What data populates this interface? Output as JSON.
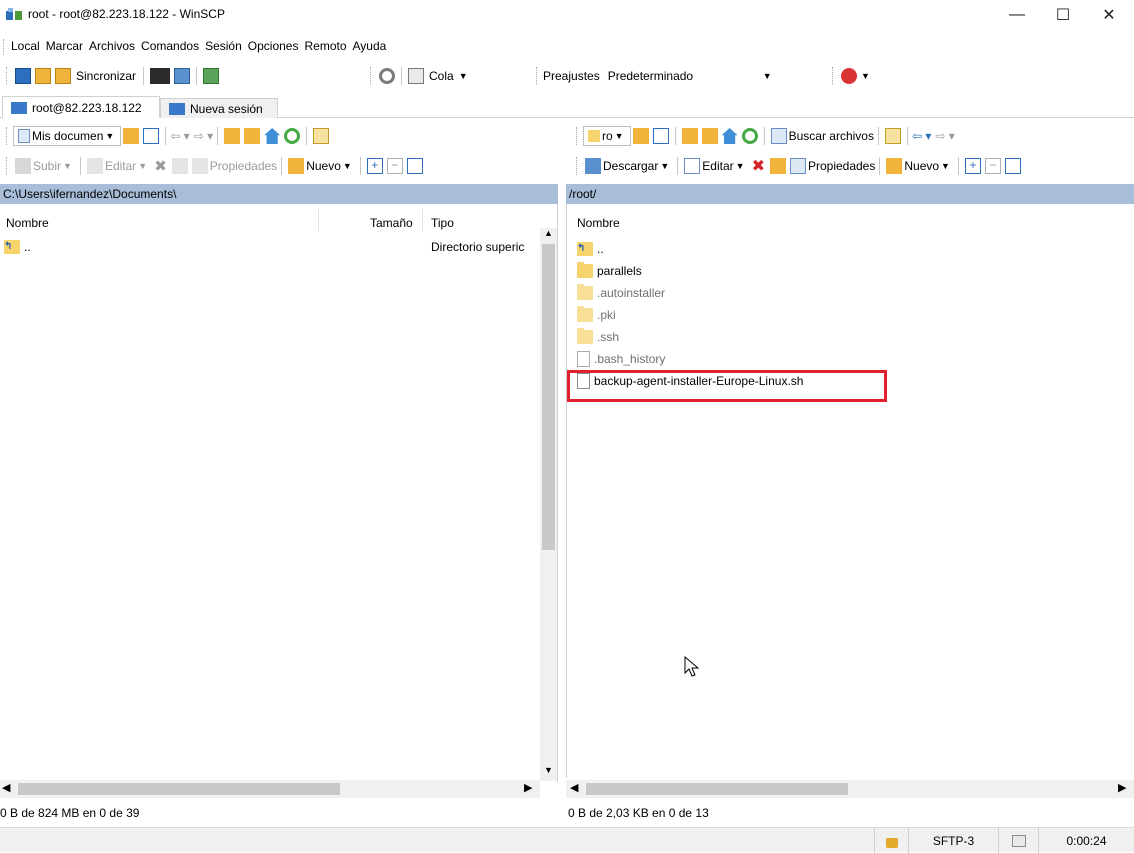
{
  "window": {
    "title": "root - root@82.223.18.122 - WinSCP",
    "controls": {
      "minimize": "—",
      "maximize": "☐",
      "close": "✕"
    }
  },
  "menubar": {
    "items": [
      "Local",
      "Marcar",
      "Archivos",
      "Comandos",
      "Sesión",
      "Opciones",
      "Remoto",
      "Ayuda"
    ]
  },
  "toolbar": {
    "sync_label": "Sincronizar",
    "queue_label": "Cola",
    "presets_label": "Preajustes",
    "presets_value": "Predeterminado"
  },
  "tabs": {
    "session": "root@82.223.18.122",
    "new_session": "Nueva sesión"
  },
  "left_panel": {
    "location_dropdown": "Mis documen",
    "upload_label": "Subir",
    "edit_label": "Editar",
    "properties_label": "Propiedades",
    "new_label": "Nuevo",
    "path": "C:\\Users\\ifernandez\\Documents\\",
    "columns": [
      "Nombre",
      "Tamaño",
      "Tipo"
    ],
    "rows": [
      {
        "name": "..",
        "size": "",
        "type": "Directorio superic"
      }
    ],
    "status": "0 B de 824 MB en 0 de 39"
  },
  "right_panel": {
    "location_dropdown": "ro",
    "find_files_label": "Buscar archivos",
    "download_label": "Descargar",
    "edit_label": "Editar",
    "properties_label": "Propiedades",
    "new_label": "Nuevo",
    "path": "/root/",
    "columns": [
      "Nombre"
    ],
    "rows": [
      {
        "name": "..",
        "kind": "up"
      },
      {
        "name": "parallels",
        "kind": "folder"
      },
      {
        "name": ".autoinstaller",
        "kind": "folder-hidden"
      },
      {
        "name": ".pki",
        "kind": "folder-hidden"
      },
      {
        "name": ".ssh",
        "kind": "folder-hidden"
      },
      {
        "name": ".bash_history",
        "kind": "file-hidden"
      },
      {
        "name": "backup-agent-installer-Europe-Linux.sh",
        "kind": "file"
      }
    ],
    "status": "0 B de 2,03 KB en 0 de 13"
  },
  "statusbar": {
    "protocol": "SFTP-3",
    "elapsed": "0:00:24"
  },
  "colors": {
    "path_bar": "#a9bcd8",
    "highlight_box": "#e0202a",
    "folder": "#f7d36b"
  }
}
